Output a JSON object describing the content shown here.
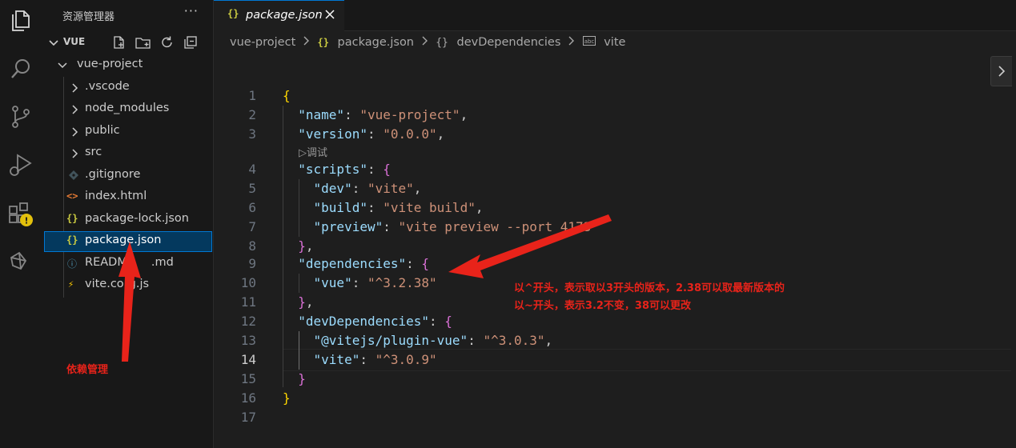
{
  "sidebar": {
    "title": "资源管理器",
    "more": "···",
    "root": "VUE",
    "items": [
      {
        "label": "vue-project",
        "kind": "folder-open"
      },
      {
        "label": ".vscode",
        "kind": "folder"
      },
      {
        "label": "node_modules",
        "kind": "folder"
      },
      {
        "label": "public",
        "kind": "folder"
      },
      {
        "label": "src",
        "kind": "folder"
      },
      {
        "label": ".gitignore",
        "kind": "git"
      },
      {
        "label": "index.html",
        "kind": "html",
        "icon": "<>"
      },
      {
        "label": "package-lock.json",
        "kind": "json",
        "icon": "{}"
      },
      {
        "label": "package.json",
        "kind": "json",
        "icon": "{}"
      },
      {
        "label": "READM",
        "suffix": ".md",
        "kind": "info",
        "icon": "ⓘ"
      },
      {
        "label": "vite.co",
        "suffix": "g.js",
        "kind": "vite",
        "icon": "⚡"
      }
    ]
  },
  "tab": {
    "icon": "{}",
    "label": "package.json"
  },
  "breadcrumbs": {
    "project": "vue-project",
    "file_icon": "{}",
    "file": "package.json",
    "object_icon": "{}",
    "section": "devDependencies",
    "key": "vite"
  },
  "editor": {
    "codelens": "▷调试",
    "lines": [
      {
        "n": "1",
        "t": [
          [
            "{",
            "b1"
          ]
        ]
      },
      {
        "n": "2",
        "t": [
          [
            "  ",
            "p"
          ],
          [
            "\"name\"",
            "k"
          ],
          [
            ": ",
            "p"
          ],
          [
            "\"vue-project\"",
            "s"
          ],
          [
            ",",
            "p"
          ]
        ]
      },
      {
        "n": "3",
        "t": [
          [
            "  ",
            "p"
          ],
          [
            "\"version\"",
            "k"
          ],
          [
            ": ",
            "p"
          ],
          [
            "\"0.0.0\"",
            "s"
          ],
          [
            ",",
            "p"
          ]
        ]
      },
      {
        "n": "4",
        "t": [
          [
            "  ",
            "p"
          ],
          [
            "\"scripts\"",
            "k"
          ],
          [
            ": ",
            "p"
          ],
          [
            "{",
            "b2"
          ]
        ]
      },
      {
        "n": "5",
        "t": [
          [
            "    ",
            "p"
          ],
          [
            "\"dev\"",
            "k"
          ],
          [
            ": ",
            "p"
          ],
          [
            "\"vite\"",
            "s"
          ],
          [
            ",",
            "p"
          ]
        ]
      },
      {
        "n": "6",
        "t": [
          [
            "    ",
            "p"
          ],
          [
            "\"build\"",
            "k"
          ],
          [
            ": ",
            "p"
          ],
          [
            "\"vite build\"",
            "s"
          ],
          [
            ",",
            "p"
          ]
        ]
      },
      {
        "n": "7",
        "t": [
          [
            "    ",
            "p"
          ],
          [
            "\"preview\"",
            "k"
          ],
          [
            ": ",
            "p"
          ],
          [
            "\"vite preview --port 4173\"",
            "s"
          ]
        ]
      },
      {
        "n": "8",
        "t": [
          [
            "  ",
            "p"
          ],
          [
            "}",
            "b2"
          ],
          [
            ",",
            "p"
          ]
        ]
      },
      {
        "n": "9",
        "t": [
          [
            "  ",
            "p"
          ],
          [
            "\"dependencies\"",
            "k"
          ],
          [
            ": ",
            "p"
          ],
          [
            "{",
            "b2"
          ]
        ]
      },
      {
        "n": "10",
        "t": [
          [
            "    ",
            "p"
          ],
          [
            "\"vue\"",
            "k"
          ],
          [
            ": ",
            "p"
          ],
          [
            "\"^3.2.38\"",
            "s"
          ]
        ]
      },
      {
        "n": "11",
        "t": [
          [
            "  ",
            "p"
          ],
          [
            "}",
            "b2"
          ],
          [
            ",",
            "p"
          ]
        ]
      },
      {
        "n": "12",
        "t": [
          [
            "  ",
            "p"
          ],
          [
            "\"devDependencies\"",
            "k"
          ],
          [
            ": ",
            "p"
          ],
          [
            "{",
            "b2"
          ]
        ]
      },
      {
        "n": "13",
        "t": [
          [
            "    ",
            "p"
          ],
          [
            "\"@vitejs/plugin-vue\"",
            "k"
          ],
          [
            ": ",
            "p"
          ],
          [
            "\"^3.0.3\"",
            "s"
          ],
          [
            ",",
            "p"
          ]
        ]
      },
      {
        "n": "14",
        "t": [
          [
            "    ",
            "p"
          ],
          [
            "\"vite\"",
            "k"
          ],
          [
            ": ",
            "p"
          ],
          [
            "\"^3.0.9\"",
            "s"
          ]
        ]
      },
      {
        "n": "15",
        "t": [
          [
            "  ",
            "p"
          ],
          [
            "}",
            "b2"
          ]
        ]
      },
      {
        "n": "16",
        "t": [
          [
            "}",
            "b1"
          ]
        ]
      },
      {
        "n": "17",
        "t": []
      }
    ],
    "active_line": "14"
  },
  "annotations": {
    "deps_label": "依赖管理",
    "caret_note": "以^开头，表示取以3开头的版本，2.38可以取最新版本的",
    "tilde_note": "以~开头，表示3.2不变，38可以更改"
  },
  "colors": {
    "accent": "#0078d4",
    "annotation": "#e8231a",
    "json_icon": "#cbcb41",
    "string": "#ce9178",
    "key": "#9cdcfe"
  }
}
